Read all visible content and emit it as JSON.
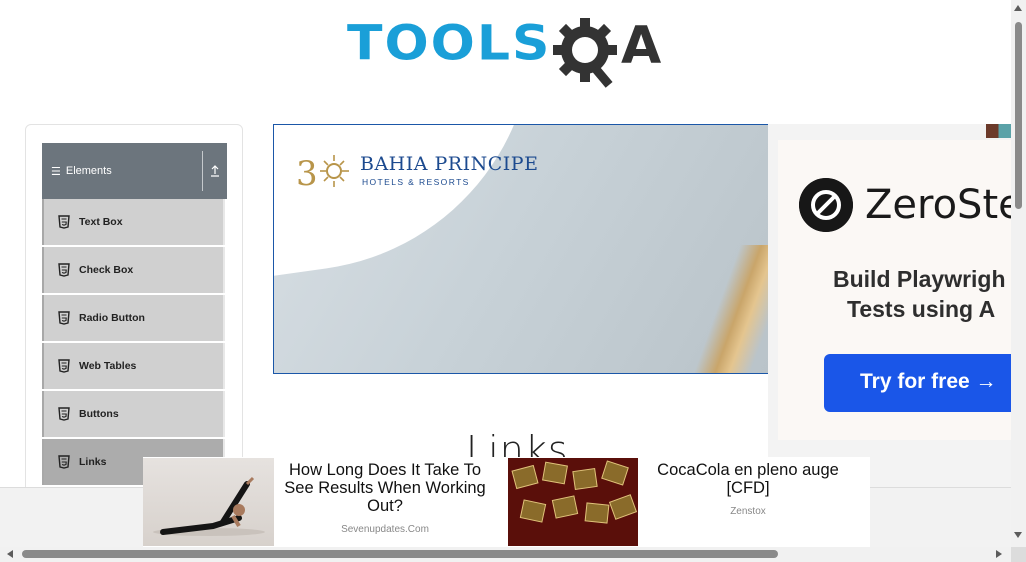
{
  "header": {
    "logo_tools": "TOOLS",
    "logo_a": "A",
    "logo_colors": {
      "tools": "#1a9fd8",
      "qa": "#333333"
    }
  },
  "sidebar": {
    "group_label": "Elements",
    "group_icon": "hamburger-icon",
    "collapse_icon": "arrow-up-icon",
    "items": [
      {
        "label": "Text Box",
        "icon": "html5-icon"
      },
      {
        "label": "Check Box",
        "icon": "html5-icon"
      },
      {
        "label": "Radio Button",
        "icon": "html5-icon"
      },
      {
        "label": "Web Tables",
        "icon": "html5-icon"
      },
      {
        "label": "Buttons",
        "icon": "html5-icon"
      },
      {
        "label": "Links",
        "icon": "html5-icon",
        "active": true
      }
    ]
  },
  "banner_ad": {
    "title": "BAHIA PRINCIPE",
    "subtitle": "HOTELS & RESORTS",
    "border_color": "#1b57a8"
  },
  "side_ad": {
    "brand": "ZeroSte",
    "tagline_line1": "Build Playwrigh",
    "tagline_line2": "Tests using A",
    "cta": "Try for free →",
    "cta_color": "#1a56e8"
  },
  "main": {
    "heading": "Links"
  },
  "bottom_ad": {
    "items": [
      {
        "headline": "How Long Does It Take To See Results When Working Out?",
        "source": "Sevenupdates.Com"
      },
      {
        "headline": "CocaCola en pleno auge [CFD]",
        "source": "Zenstox"
      }
    ]
  }
}
